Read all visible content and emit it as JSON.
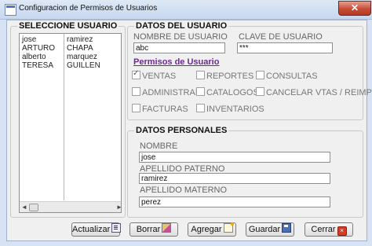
{
  "window": {
    "title": "Configuracion de Permisos de Usuarios",
    "close_glyph": "✕"
  },
  "users_group": {
    "title": "SELECCIONE USUARIO",
    "rows": [
      [
        "jose",
        "ramirez"
      ],
      [
        "ARTURO",
        "CHAPA"
      ],
      [
        "alberto",
        "marquez"
      ],
      [
        "TERESA",
        "GUILLEN"
      ]
    ],
    "scroll_left": "◄",
    "scroll_right": "►"
  },
  "user_data": {
    "title": "DATOS DEL USUARIO",
    "username_label": "NOMBRE DE USUARIO",
    "username_value": "abc",
    "password_label": "CLAVE DE USUARIO",
    "password_value": "***"
  },
  "permissions": {
    "title": "Permisos de Usuario",
    "items": [
      {
        "label": "VENTAS",
        "checked": true
      },
      {
        "label": "REPORTES",
        "checked": false
      },
      {
        "label": "CONSULTAS",
        "checked": false
      },
      {
        "label": "ADMINISTRAR",
        "checked": false
      },
      {
        "label": "CATALOGOS",
        "checked": false
      },
      {
        "label": "CANCELAR VTAS / REIMP",
        "checked": false
      },
      {
        "label": "FACTURAS",
        "checked": false
      },
      {
        "label": "INVENTARIOS",
        "checked": false
      }
    ]
  },
  "personal_data": {
    "title": "DATOS PERSONALES",
    "name_label": "NOMBRE",
    "name_value": "jose",
    "paternal_label": "APELLIDO PATERNO",
    "paternal_value": "ramirez",
    "maternal_label": "APELLIDO MATERNO",
    "maternal_value": "perez"
  },
  "buttons": {
    "update": "Actualizar",
    "delete": "Borrar",
    "add": "Agregar",
    "save": "Guardar",
    "close": "Cerrar"
  }
}
